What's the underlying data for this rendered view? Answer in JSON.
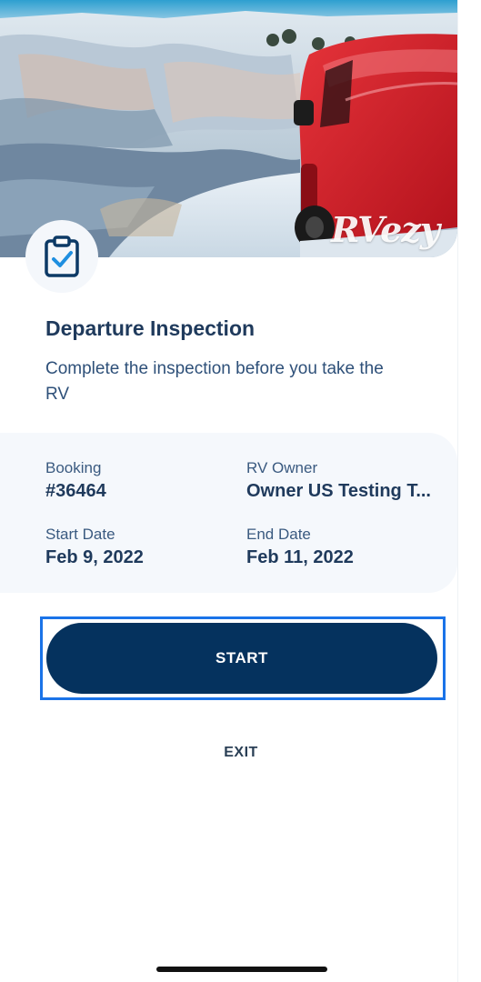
{
  "hero": {
    "watermark": "RVezy"
  },
  "icons": {
    "badge": "clipboard-check-icon"
  },
  "inspection": {
    "title": "Departure Inspection",
    "subtitle": "Complete the inspection before you take the RV"
  },
  "details": {
    "booking_label": "Booking",
    "booking_value": "#36464",
    "owner_label": "RV Owner",
    "owner_value": "Owner US Testing T...",
    "start_label": "Start Date",
    "start_value": "Feb 9, 2022",
    "end_label": "End Date",
    "end_value": "Feb 11, 2022"
  },
  "actions": {
    "start_label": "START",
    "exit_label": "EXIT"
  },
  "colors": {
    "primary": "#05325e",
    "focus": "#1a73e8",
    "text": "#1f3a5c",
    "card_bg": "#f5f8fc"
  }
}
